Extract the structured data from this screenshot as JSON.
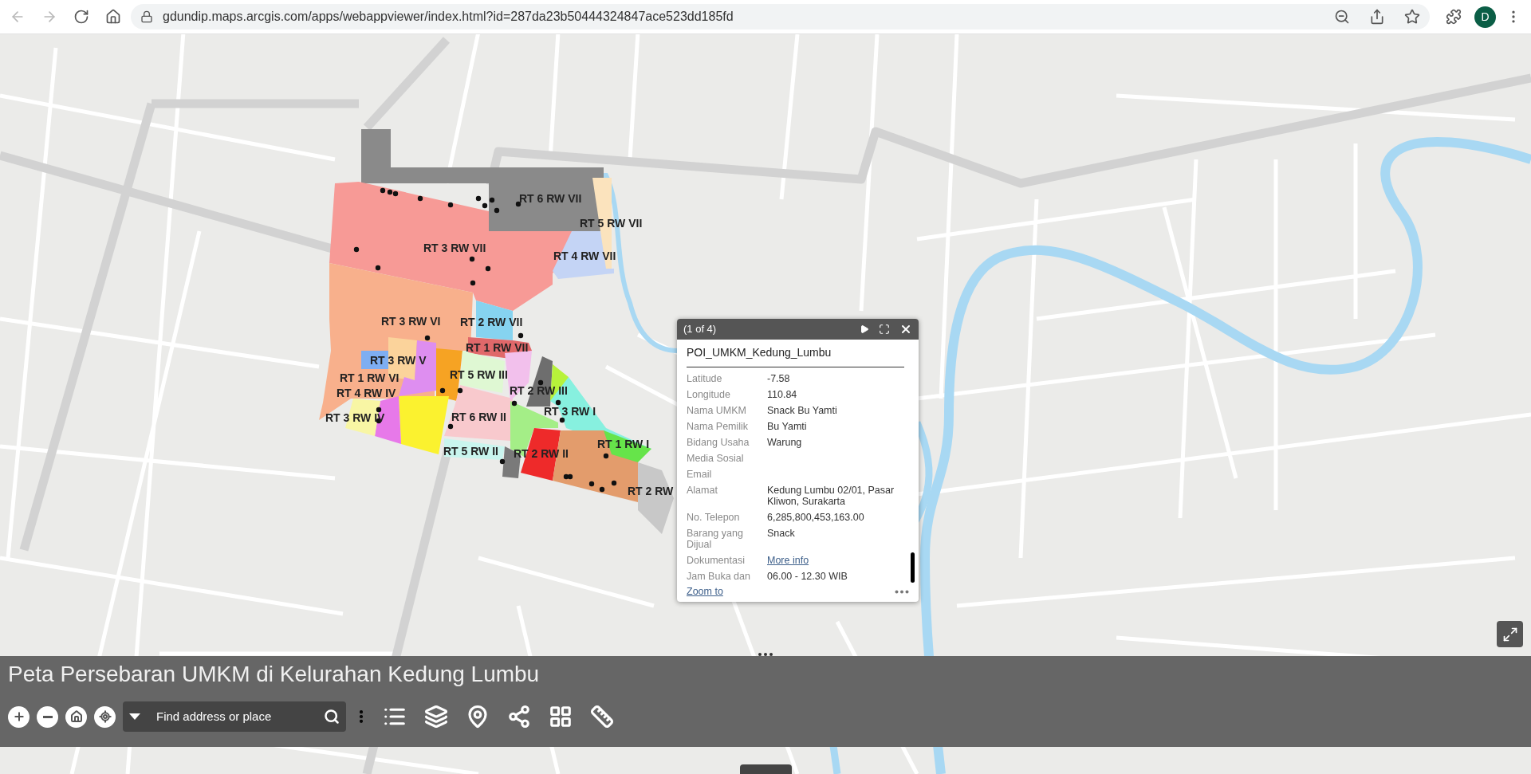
{
  "browser": {
    "url": "gdundip.maps.arcgis.com/apps/webappviewer/index.html?id=287da23b50444324847ace523dd185fd",
    "profile_initial": "D"
  },
  "map": {
    "area_labels": [
      "RT 6 RW VII",
      "RT 5 RW VII",
      "RT 3 RW VII",
      "RT 4 RW VII",
      "RT 3 RW VI",
      "RT 2 RW VII",
      "RT 1 RW VII",
      "RT 3 RW V",
      "RT 5 RW III",
      "RT 1 RW VI",
      "RT 2 RW III",
      "RT 4 RW IV",
      "RT 3 RW I",
      "RT 3 RW IV",
      "RT 6 RW II",
      "RT 1 RW I",
      "RT 5 RW II",
      "RT 2 RW II",
      "RT 2 RW"
    ]
  },
  "popup": {
    "counter": "(1 of 4)",
    "layer_title": "POI_UMKM_Kedung_Lumbu",
    "fields": [
      {
        "label": "Latitude",
        "value": "-7.58",
        "kind": "text"
      },
      {
        "label": "Longitude",
        "value": "110.84",
        "kind": "text"
      },
      {
        "label": "Nama UMKM",
        "value": "Snack Bu Yamti",
        "kind": "text"
      },
      {
        "label": "Nama Pemilik",
        "value": "Bu Yamti",
        "kind": "text"
      },
      {
        "label": "Bidang Usaha",
        "value": "Warung",
        "kind": "text"
      },
      {
        "label": "Media Sosial"
      },
      {
        "label": "Email"
      },
      {
        "label": "Alamat",
        "value": "Kedung Lumbu 02/01, Pasar Kliwon, Surakarta",
        "kind": "text"
      },
      {
        "label": "No. Telepon",
        "value": "6,285,800,453,163.00",
        "kind": "text"
      },
      {
        "label": "Barang yang Dijual",
        "value": "Snack",
        "kind": "text"
      },
      {
        "label": "Dokumentasi",
        "value": "More info",
        "kind": "link"
      },
      {
        "label": "Jam Buka dan",
        "value": "06.00 - 12.30 WIB",
        "kind": "text"
      }
    ],
    "footer_link": "Zoom to"
  },
  "app": {
    "title": "Peta Persebaran UMKM di Kelurahan Kedung Lumbu",
    "search": {
      "placeholder": "Find address or place"
    }
  }
}
